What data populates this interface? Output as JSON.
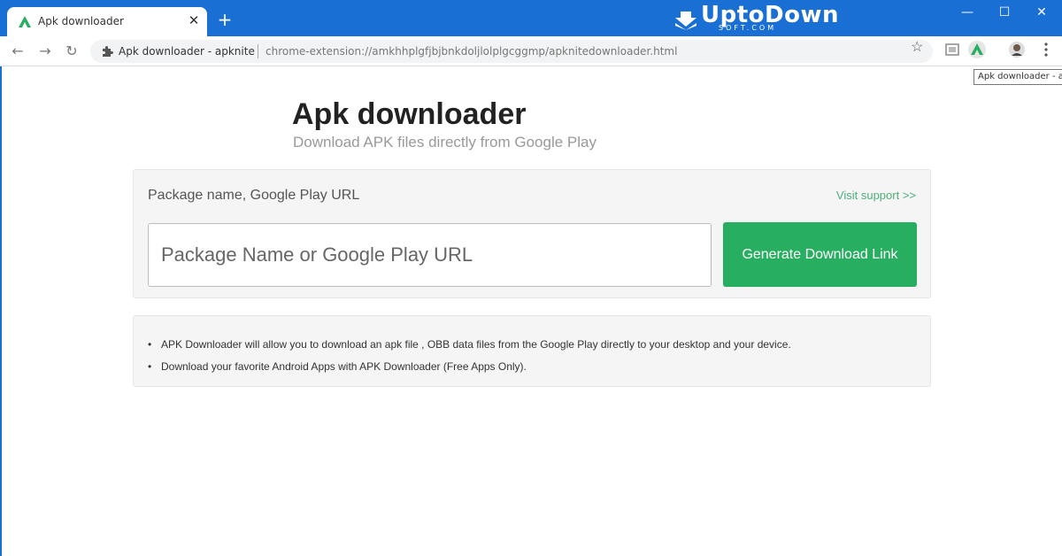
{
  "browser": {
    "tab_title": "Apk downloader",
    "tab_close": "✕",
    "new_tab": "+",
    "window_controls": {
      "minimize": "—",
      "maximize": "☐",
      "close": "✕"
    },
    "omnibox_site": "Apk downloader - apknite",
    "omnibox_url": "chrome-extension://amkhhplgfjbjbnkdoljlolplgcggmp/apknitedownloader.html",
    "tooltip": "Apk downloader - a",
    "nav": {
      "back": "←",
      "forward": "→",
      "reload": "↻"
    },
    "star": "☆"
  },
  "watermark": {
    "brand": "UptoDown",
    "sub": "SOFT.COM"
  },
  "page": {
    "title": "Apk downloader",
    "subtitle": "Download APK files directly from Google Play"
  },
  "form": {
    "label": "Package name, Google Play URL",
    "support_link": "Visit support >>",
    "input_placeholder": "Package Name or Google Play URL",
    "input_value": "",
    "button_label": "Generate Download Link"
  },
  "info": {
    "items": [
      "APK Downloader will allow you to download an apk file , OBB data files from the Google Play directly to your desktop and your device.",
      "Download your favorite Android Apps with APK Downloader (Free Apps Only)."
    ]
  },
  "colors": {
    "titlebar": "#1a6fd4",
    "accent_green": "#27ae60",
    "link_green": "#4caf7a"
  }
}
